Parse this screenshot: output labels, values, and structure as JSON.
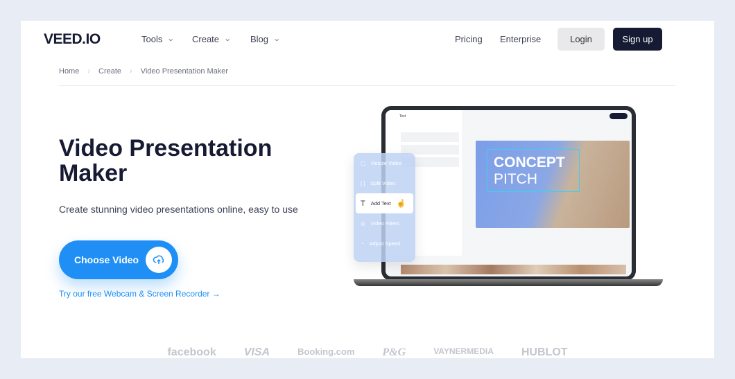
{
  "header": {
    "logo": "VEED.IO",
    "nav": [
      {
        "label": "Tools"
      },
      {
        "label": "Create"
      },
      {
        "label": "Blog"
      }
    ],
    "pricing": "Pricing",
    "enterprise": "Enterprise",
    "login": "Login",
    "signup": "Sign up"
  },
  "breadcrumb": [
    "Home",
    "Create",
    "Video Presentation Maker"
  ],
  "hero": {
    "title": "Video Presentation Maker",
    "subtitle": "Create stunning video presentations online, easy to use",
    "cta": "Choose Video",
    "link": "Try our free Webcam & Screen Recorder →"
  },
  "mockup": {
    "panel_title": "Text",
    "video_title_1": "CONCEPT",
    "video_title_2": "PITCH",
    "menu": [
      "Resize Video",
      "Split Video",
      "Add Text",
      "Video Filters",
      "Adjust Speed"
    ]
  },
  "logos": [
    "facebook",
    "VISA",
    "Booking.com",
    "P&G",
    "VAYNERMEDIA",
    "HUBLOT"
  ],
  "colors": {
    "accent": "#1f8ff5",
    "dark": "#161b33",
    "background": "#e8ecf4"
  }
}
